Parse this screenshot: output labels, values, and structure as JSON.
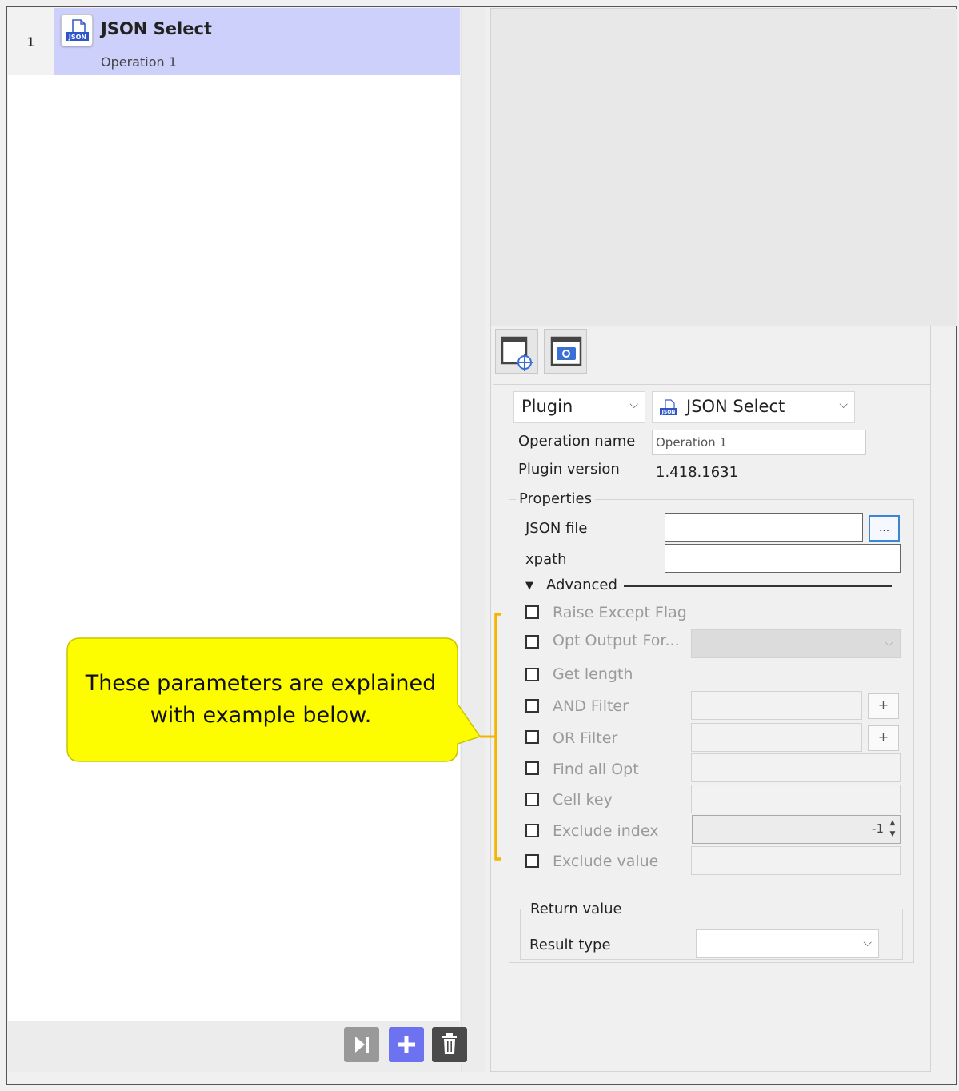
{
  "operations": [
    {
      "number": "1",
      "title": "JSON Select",
      "subtitle": "Operation 1",
      "icon": "json-file-icon"
    }
  ],
  "bottom_toolbar": {
    "buttons": [
      {
        "name": "skip-button",
        "icon": "skip-forward-icon",
        "color": "#999999"
      },
      {
        "name": "add-button",
        "icon": "plus-icon",
        "color": "#6d72f0"
      },
      {
        "name": "delete-button",
        "icon": "trash-icon",
        "color": "#4a4a4a"
      }
    ]
  },
  "preview_toolbar": {
    "buttons": [
      {
        "name": "select-window-button",
        "icon": "window-target-icon"
      },
      {
        "name": "screenshot-button",
        "icon": "window-camera-icon"
      }
    ]
  },
  "properties": {
    "type_select": "Plugin",
    "plugin_select": "JSON Select",
    "operation_name_label": "Operation name",
    "operation_name_value": "Operation 1",
    "plugin_version_label": "Plugin version",
    "plugin_version_value": "1.418.1631",
    "properties_legend": "Properties",
    "json_file_label": "JSON file",
    "json_file_value": "",
    "browse_label": "...",
    "xpath_label": "xpath",
    "xpath_value": "",
    "advanced_label": "Advanced",
    "advanced_options": [
      {
        "label": "Raise Except Flag",
        "checked": false
      },
      {
        "label": "Opt Output For...",
        "checked": false
      },
      {
        "label": "Get length",
        "checked": false
      },
      {
        "label": "AND Filter",
        "checked": false
      },
      {
        "label": "OR Filter",
        "checked": false
      },
      {
        "label": "Find all Opt",
        "checked": false
      },
      {
        "label": "Cell key",
        "checked": false
      },
      {
        "label": "Exclude index",
        "checked": false
      },
      {
        "label": "Exclude value",
        "checked": false
      }
    ],
    "plus_label": "+",
    "exclude_index_value": "-1",
    "return_value_legend": "Return value",
    "result_type_label": "Result type",
    "result_type_value": ""
  },
  "callout": {
    "line1": "These parameters are explained",
    "line2": "with example below.",
    "fill_color": "#fdfd00",
    "bracket_color": "#f5b400"
  }
}
